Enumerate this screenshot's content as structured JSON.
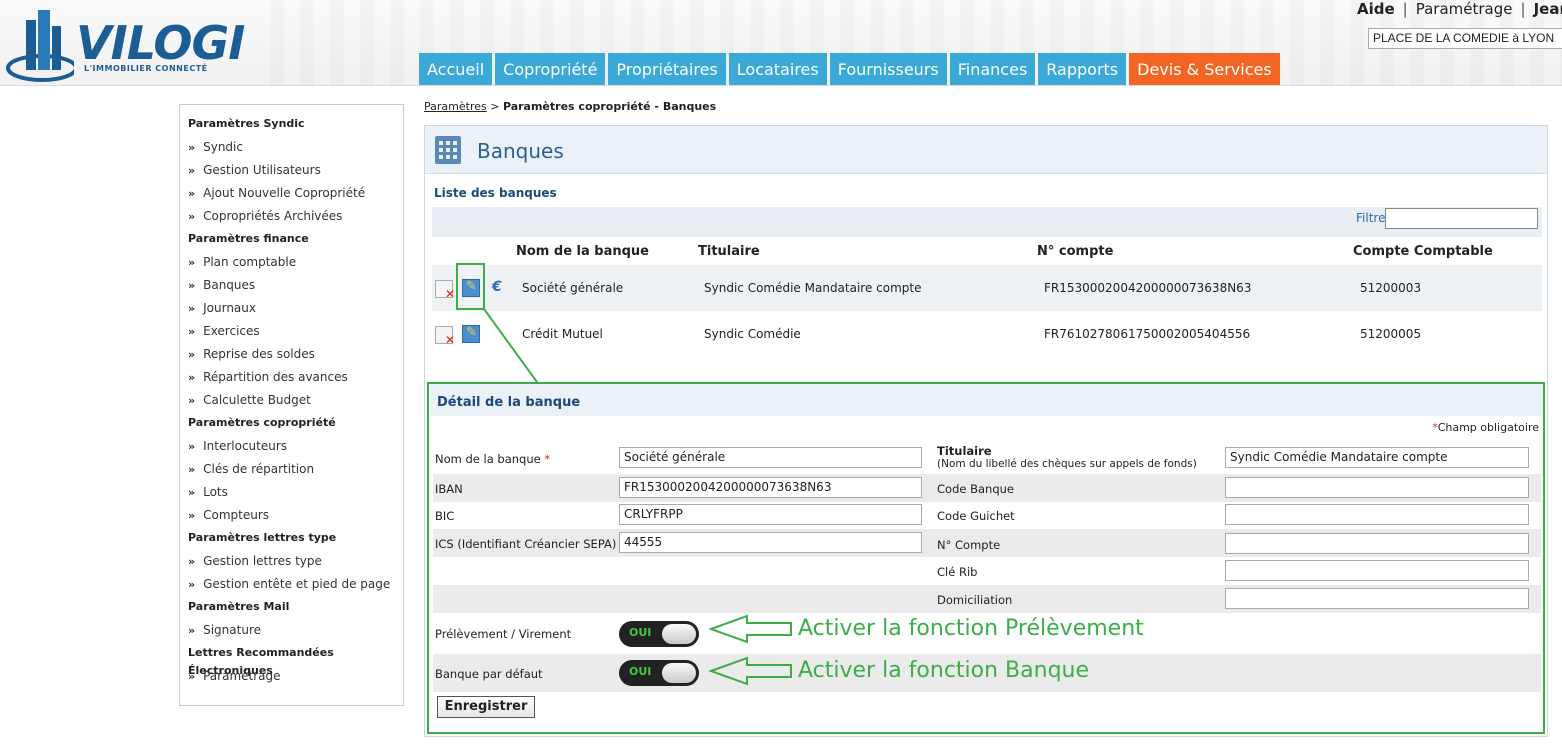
{
  "header": {
    "logo_text": "VILOGI",
    "logo_tagline": "L'IMMOBILIER CONNECTÉ",
    "links": {
      "help": "Aide",
      "settings": "Paramétrage",
      "user": "Jean"
    },
    "copro_select": "PLACE DE LA COMEDIE à LYON",
    "nav": [
      "Accueil",
      "Copropriété",
      "Propriétaires",
      "Locataires",
      "Fournisseurs",
      "Finances",
      "Rapports",
      "Devis & Services"
    ]
  },
  "sidebar": {
    "sections": [
      {
        "title": "Paramètres Syndic",
        "items": [
          "Syndic",
          "Gestion Utilisateurs",
          "Ajout Nouvelle Copropriété",
          "Copropriétés Archivées"
        ]
      },
      {
        "title": "Paramètres finance",
        "items": [
          "Plan comptable",
          "Banques",
          "Journaux",
          "Exercices",
          "Reprise des soldes",
          "Répartition des avances",
          "Calculette Budget"
        ]
      },
      {
        "title": "Paramètres copropriété",
        "items": [
          "Interlocuteurs",
          "Clés de répartition",
          "Lots",
          "Compteurs"
        ]
      },
      {
        "title": "Paramètres lettres type",
        "items": [
          "Gestion lettres type",
          "Gestion entête et pied de page"
        ]
      },
      {
        "title": "Paramètres Mail",
        "items": [
          "Signature"
        ]
      },
      {
        "title": "Lettres Recommandées Électroniques",
        "items": [
          "Paramétrage"
        ]
      }
    ],
    "chevron": "»"
  },
  "breadcrumb": {
    "parent": "Paramètres",
    "separator": ">",
    "current": "Paramètres copropriété - Banques"
  },
  "main": {
    "title": "Banques",
    "list_title": "Liste des banques",
    "filter_label": "Filtre",
    "columns": [
      "Nom de la banque",
      "Titulaire",
      "N° compte",
      "Compte Comptable"
    ],
    "rows": [
      {
        "name": "Société générale",
        "holder": "Syndic Comédie Mandataire compte",
        "account": "FR1530002004200000073638N63",
        "ledger": "51200003",
        "euro": "€"
      },
      {
        "name": "Crédit Mutuel",
        "holder": "Syndic Comédie",
        "account": "FR7610278061750002005404556",
        "ledger": "51200005"
      }
    ]
  },
  "detail": {
    "title": "Détail de la banque",
    "required_star": "*",
    "required_note": "Champ obligatoire",
    "fields": {
      "bank_name_label": "Nom de la banque",
      "bank_name_value": "Société générale",
      "holder_label": "Titulaire",
      "holder_sublabel": "(Nom du libellé des chèques sur appels de fonds)",
      "holder_value": "Syndic Comédie Mandataire compte",
      "iban_label": "IBAN",
      "iban_value": "FR1530002004200000073638N63",
      "code_banque_label": "Code Banque",
      "bic_label": "BIC",
      "bic_value": "CRLYFRPP",
      "code_guichet_label": "Code Guichet",
      "ics_label": "ICS (Identifiant Créancier SEPA)",
      "ics_value": "44555",
      "num_compte_label": "N° Compte",
      "cle_rib_label": "Clé Rib",
      "domiciliation_label": "Domiciliation",
      "prelevement_label": "Prélèvement / Virement",
      "banque_defaut_label": "Banque par défaut",
      "toggle_on": "OUI"
    },
    "save_button": "Enregistrer"
  },
  "annotations": {
    "prelevement": "Activer la fonction Prélèvement",
    "banque": "Activer la fonction Banque"
  },
  "colors": {
    "nav_blue": "#3aa9d8",
    "nav_orange": "#f26522",
    "annotation_green": "#3cae48",
    "title_blue": "#2b5f94"
  }
}
